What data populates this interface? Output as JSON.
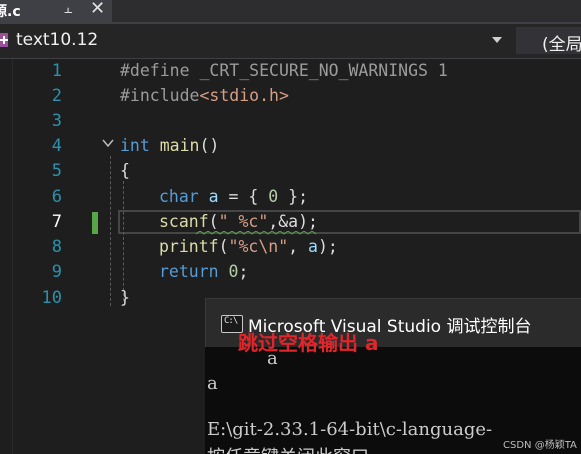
{
  "tabs": {
    "active_tab": "源.c",
    "pin_icon": "pin-icon",
    "close_icon": "close-icon"
  },
  "navbar": {
    "project": "text10.12",
    "scope": "(全局"
  },
  "editor": {
    "lines": [
      {
        "n": "1"
      },
      {
        "n": "2"
      },
      {
        "n": "3"
      },
      {
        "n": "4"
      },
      {
        "n": "5"
      },
      {
        "n": "6"
      },
      {
        "n": "7"
      },
      {
        "n": "8"
      },
      {
        "n": "9"
      },
      {
        "n": "10"
      }
    ],
    "code": {
      "l1_pre": "#define ",
      "l1_macro": "_CRT_SECURE_NO_WARNINGS ",
      "l1_val": "1",
      "l2_pre": "#include",
      "l2_hdr": "<stdio.h>",
      "l4_kw": "int ",
      "l4_fn": "main",
      "l4_rest": "()",
      "l5": "{",
      "l6_kw": "char ",
      "l6_var": "a",
      "l6_mid": " = { ",
      "l6_num": "0",
      "l6_end": " };",
      "l7_fn": "scanf",
      "l7_open": "(",
      "l7_str": "\" %c\"",
      "l7_rest": ",&a);",
      "l8_fn": "printf",
      "l8_open": "(",
      "l8_str": "\"%c\\n\"",
      "l8_mid": ", ",
      "l8_var": "a",
      "l8_end": ");",
      "l9_kw": "return ",
      "l9_num": "0",
      "l9_end": ";",
      "l10": "}"
    }
  },
  "console": {
    "title": "Microsoft Visual Studio 调试控制台",
    "input_echo": "a",
    "output": "a",
    "annotation": "跳过空格输出 a",
    "path": "E:\\git-2.33.1-64-bit\\c-language-",
    "press_key": "按任意键关闭此窗口"
  },
  "watermark": "CSDN @杨颖TA",
  "colors": {
    "background": "#1e1e1e",
    "keyword": "#569cd6",
    "string": "#d69d85",
    "line_number": "#2b91af",
    "annotation": "#e0252b",
    "change_bar": "#57a64a"
  }
}
